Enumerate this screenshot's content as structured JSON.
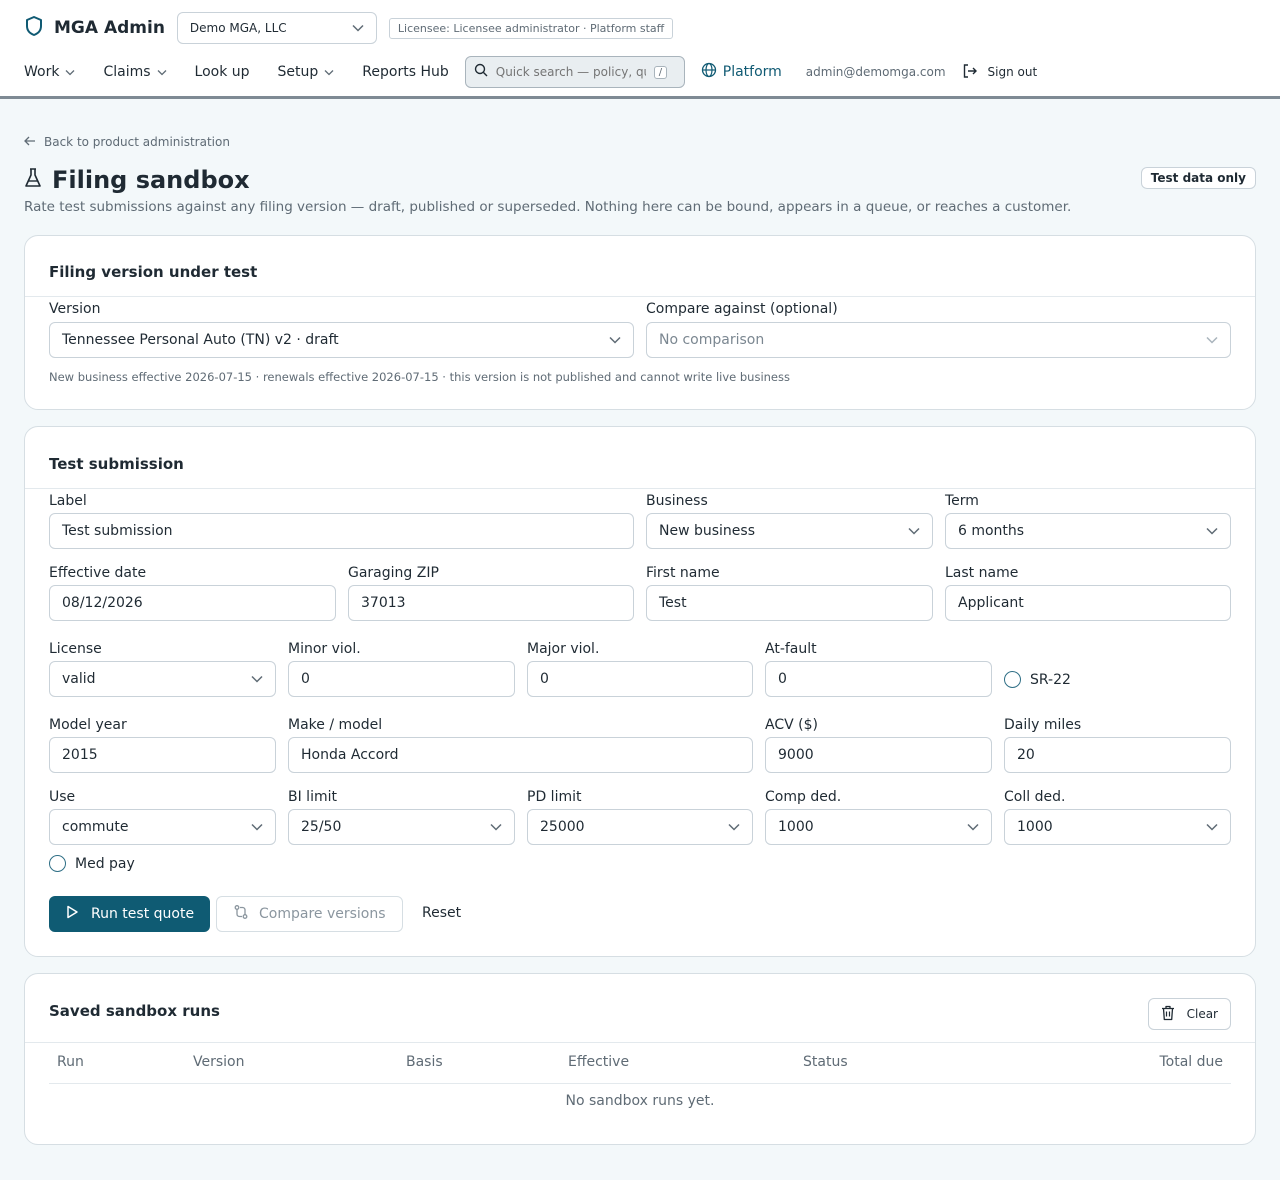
{
  "header": {
    "brand": "MGA Admin",
    "org_select": "Demo MGA, LLC",
    "role_pill": "Licensee: Licensee administrator · Platform staff",
    "nav": {
      "work": "Work",
      "claims": "Claims",
      "lookup": "Look up",
      "setup": "Setup",
      "reports": "Reports Hub"
    },
    "search_placeholder": "Quick search — policy, quote",
    "search_kbd": "/",
    "platform": "Platform",
    "email": "admin@demomga.com",
    "signout": "Sign out"
  },
  "page": {
    "back_link": "Back to product administration",
    "title": "Filing sandbox",
    "badge": "Test data only",
    "subtitle": "Rate test submissions against any filing version — draft, published or superseded. Nothing here can be bound, appears in a queue, or reaches a customer."
  },
  "version_card": {
    "title": "Filing version under test",
    "version_label": "Version",
    "version_value": "Tennessee Personal Auto (TN) v2 · draft",
    "compare_label": "Compare against (optional)",
    "compare_placeholder": "No comparison",
    "help": "New business effective 2026-07-15 · renewals effective 2026-07-15 · this version is not published and cannot write live business"
  },
  "submission_card": {
    "title": "Test submission",
    "fields": {
      "label": {
        "label": "Label",
        "value": "Test submission"
      },
      "business": {
        "label": "Business",
        "value": "New business"
      },
      "term": {
        "label": "Term",
        "value": "6 months"
      },
      "effective_date": {
        "label": "Effective date",
        "value": "08/12/2026"
      },
      "garaging_zip": {
        "label": "Garaging ZIP",
        "value": "37013"
      },
      "first_name": {
        "label": "First name",
        "value": "Test"
      },
      "last_name": {
        "label": "Last name",
        "value": "Applicant"
      },
      "license": {
        "label": "License",
        "value": "valid"
      },
      "minor_viol": {
        "label": "Minor viol.",
        "value": "0"
      },
      "major_viol": {
        "label": "Major viol.",
        "value": "0"
      },
      "at_fault": {
        "label": "At-fault",
        "value": "0"
      },
      "sr22": {
        "label": "SR-22"
      },
      "model_year": {
        "label": "Model year",
        "value": "2015"
      },
      "make_model": {
        "label": "Make / model",
        "value": "Honda Accord"
      },
      "acv": {
        "label": "ACV ($)",
        "value": "9000"
      },
      "daily_miles": {
        "label": "Daily miles",
        "value": "20"
      },
      "use": {
        "label": "Use",
        "value": "commute"
      },
      "bi_limit": {
        "label": "BI limit",
        "value": "25/50"
      },
      "pd_limit": {
        "label": "PD limit",
        "value": "25000"
      },
      "comp_ded": {
        "label": "Comp ded.",
        "value": "1000"
      },
      "coll_ded": {
        "label": "Coll ded.",
        "value": "1000"
      },
      "med_pay": {
        "label": "Med pay"
      }
    },
    "run_button": "Run test quote",
    "compare_button": "Compare versions",
    "reset_button": "Reset"
  },
  "runs_card": {
    "title": "Saved sandbox runs",
    "clear_button": "Clear",
    "columns": [
      "Run",
      "Version",
      "Basis",
      "Effective",
      "Status",
      "Total due"
    ],
    "empty": "No sandbox runs yet."
  },
  "colors": {
    "accent": "#0f5b73",
    "background": "#f3f8fa"
  }
}
